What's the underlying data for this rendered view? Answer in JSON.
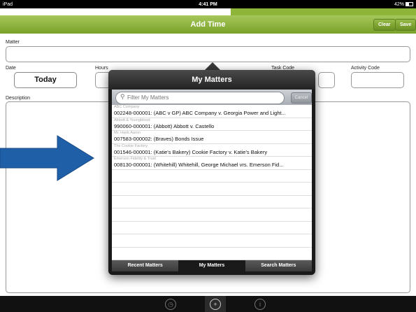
{
  "status": {
    "device": "iPad",
    "time": "4:41 PM",
    "battery": "42%"
  },
  "header": {
    "title": "Add Time",
    "clear_label": "Clear",
    "save_label": "Save"
  },
  "form": {
    "matter_label": "Matter",
    "date_label": "Date",
    "date_value": "Today",
    "hours_label": "Hours",
    "task_code_label": "Task Code",
    "activity_code_label": "Activity Code",
    "description_label": "Description"
  },
  "popover": {
    "title": "My Matters",
    "search_placeholder": "Filter My Matters",
    "cancel_label": "Cancel",
    "items": [
      {
        "client": "ABC Company",
        "matter": "002248-000001: (ABC v GP)  ABC Company v. Georgia Power and Light..."
      },
      {
        "client": "Abbott & Youngblood",
        "matter": "990060-000001: (Abbott)  Abbott v. Castello"
      },
      {
        "client": "Mr. Hank Aaron",
        "matter": "007583-000002: (Braves)  Bonds Issue"
      },
      {
        "client": "The Cookie Factory",
        "matter": "001546-000001: (Katie's Bakery)  Cookie Factory v. Katie's Bakery"
      },
      {
        "client": "Emerson Fidelity & Trust",
        "matter": "008130-000001: (Whitehill)  Whitehill, George Michael vrs. Emerson Fid..."
      }
    ],
    "tabs": [
      "Recent Matters",
      "My Matters",
      "Search Matters"
    ]
  },
  "colors": {
    "accent": "#8fb43a",
    "arrow": "#1f5fa8"
  },
  "icons": {
    "clock": "clock-icon",
    "add_time": "add-time-icon",
    "info": "info-icon"
  }
}
